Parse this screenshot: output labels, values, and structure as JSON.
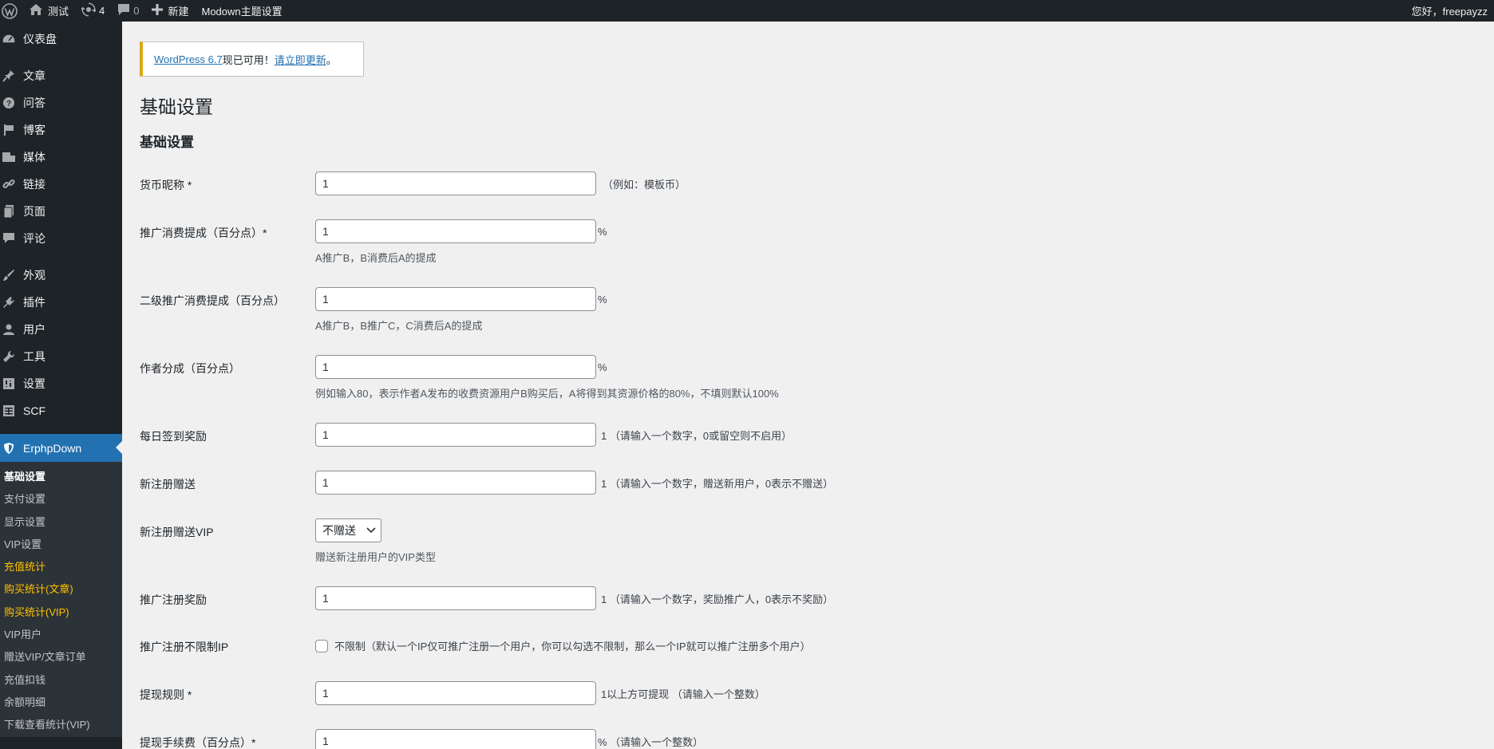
{
  "adminbar": {
    "site_name": "测试",
    "updates_count": "4",
    "comments_count": "0",
    "new_label": "新建",
    "theme_settings_label": "Modown主题设置",
    "greeting": "您好，freepayzz"
  },
  "sidebar": {
    "items": [
      {
        "label": "仪表盘",
        "icon": "dashboard-icon"
      },
      {
        "label": "文章",
        "icon": "pin-icon"
      },
      {
        "label": "问答",
        "icon": "question-icon"
      },
      {
        "label": "博客",
        "icon": "flag-icon"
      },
      {
        "label": "媒体",
        "icon": "media-icon"
      },
      {
        "label": "链接",
        "icon": "link-icon"
      },
      {
        "label": "页面",
        "icon": "page-icon"
      },
      {
        "label": "评论",
        "icon": "comment-icon"
      },
      {
        "label": "外观",
        "icon": "brush-icon"
      },
      {
        "label": "插件",
        "icon": "plugin-icon"
      },
      {
        "label": "用户",
        "icon": "user-icon"
      },
      {
        "label": "工具",
        "icon": "wrench-icon"
      },
      {
        "label": "设置",
        "icon": "settings-icon"
      },
      {
        "label": "SCF",
        "icon": "table-icon"
      },
      {
        "label": "ErphpDown",
        "icon": "shield-icon"
      }
    ],
    "submenu": [
      "基础设置",
      "支付设置",
      "显示设置",
      "VIP设置",
      "充值统计",
      "购买统计(文章)",
      "购买统计(VIP)",
      "VIP用户",
      "赠送VIP/文章订单",
      "充值扣钱",
      "余额明细",
      "下载查看统计(VIP)"
    ]
  },
  "notice": {
    "link1": "WordPress 6.7",
    "text": " 现已可用！",
    "link2": "请立即更新",
    "end": "。"
  },
  "page_title": "基础设置",
  "section_title": "基础设置",
  "form": {
    "currency_name": {
      "label": "货币昵称 *",
      "value": "1",
      "suffix": "（例如：模板币）"
    },
    "promo_rate": {
      "label": "推广消费提成（百分点）*",
      "value": "1",
      "suffix": "%",
      "desc": "A推广B，B消费后A的提成"
    },
    "promo_rate2": {
      "label": "二级推广消费提成（百分点）",
      "value": "1",
      "suffix": "%",
      "desc": "A推广B，B推广C，C消费后A的提成"
    },
    "author_share": {
      "label": "作者分成（百分点）",
      "value": "1",
      "suffix": "%",
      "desc": "例如输入80，表示作者A发布的收费资源用户B购买后，A将得到其资源价格的80%，不填则默认100%"
    },
    "daily_checkin": {
      "label": "每日签到奖励",
      "value": "1",
      "suffix": "1 （请输入一个数字，0或留空则不启用）"
    },
    "signup_gift": {
      "label": "新注册赠送",
      "value": "1",
      "suffix": "1 （请输入一个数字，赠送新用户，0表示不赠送）"
    },
    "signup_vip": {
      "label": "新注册赠送VIP",
      "selected": "不赠送",
      "desc": "赠送新注册用户的VIP类型"
    },
    "promo_signup_reward": {
      "label": "推广注册奖励",
      "value": "1",
      "suffix": "1 （请输入一个数字，奖励推广人，0表示不奖励）"
    },
    "promo_ip_unlimited": {
      "label": "推广注册不限制IP",
      "checkbox_label": "不限制（默认一个IP仅可推广注册一个用户，你可以勾选不限制，那么一个IP就可以推广注册多个用户）"
    },
    "withdraw_rule": {
      "label": "提现规则 *",
      "value": "1",
      "suffix": "1以上方可提现 （请输入一个整数）"
    },
    "withdraw_fee": {
      "label": "提现手续费（百分点）*",
      "value": "1",
      "suffix": "% （请输入一个整数）"
    }
  }
}
